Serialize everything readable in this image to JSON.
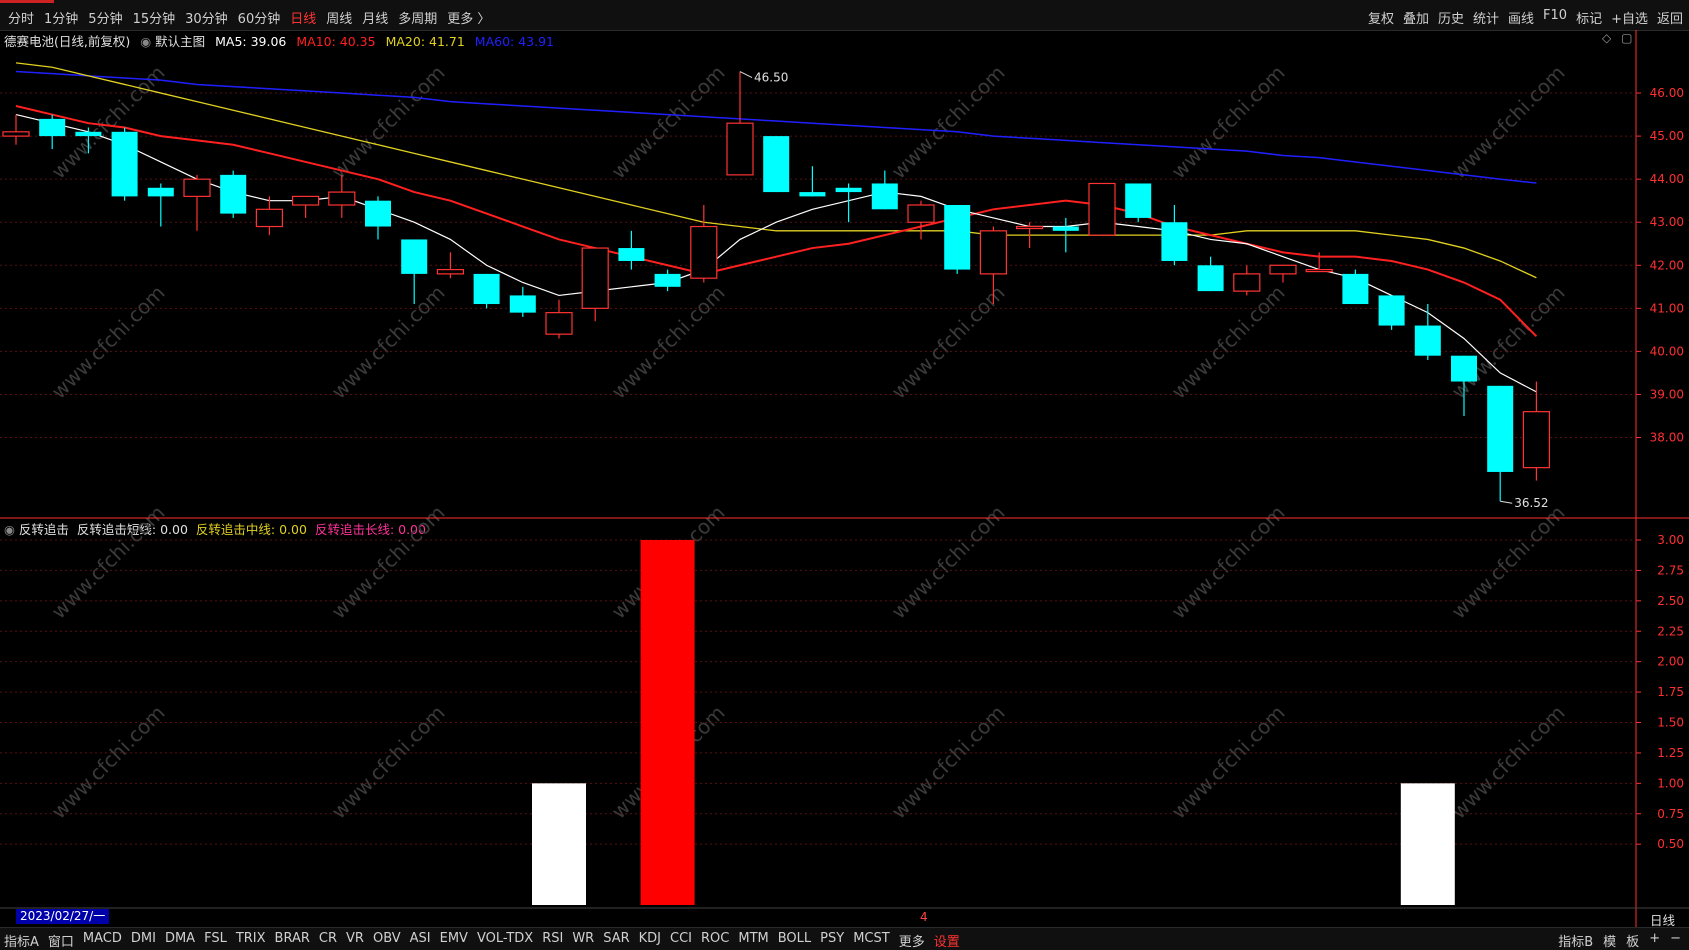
{
  "topbar": {
    "left": [
      "分时",
      "1分钟",
      "5分钟",
      "15分钟",
      "30分钟",
      "60分钟",
      "日线",
      "周线",
      "月线",
      "多周期",
      "更多 〉"
    ],
    "active_index": 6,
    "right": [
      "复权",
      "叠加",
      "历史",
      "统计",
      "画线",
      "F10",
      "标记",
      "+自选",
      "返回"
    ]
  },
  "main_info": {
    "stock": "德赛电池(日线,前复权)",
    "template": "默认主图",
    "ma5": "MA5: 39.06",
    "ma10": "MA10: 40.35",
    "ma20": "MA20: 41.71",
    "ma60": "MA60: 43.91"
  },
  "sub_info": {
    "name": "反转追击",
    "short": "反转追击短线: 0.00",
    "mid": "反转追击中线: 0.00",
    "long": "反转追击长线: 0.00"
  },
  "colors": {
    "up": "#ff3333",
    "down": "#00ffff",
    "ma5": "#ffffff",
    "ma10": "#ff2020",
    "ma20": "#e0d020",
    "ma60": "#2020ff",
    "axis": "#ff3030"
  },
  "annotations": {
    "high": "46.50",
    "low": "36.52"
  },
  "price_axis": [
    "46.00",
    "45.00",
    "44.00",
    "43.00",
    "42.00",
    "41.00",
    "40.00",
    "39.00",
    "38.00"
  ],
  "sub_axis": [
    "3.00",
    "2.75",
    "2.50",
    "2.25",
    "2.00",
    "1.75",
    "1.50",
    "1.25",
    "1.00",
    "0.75",
    "0.50"
  ],
  "date_label": "2023/02/27/一",
  "month_marker": "4",
  "period_label": "日线",
  "watermark": "www.cfchi.com",
  "bottombar": {
    "left": [
      "指标A",
      "窗口",
      "MACD",
      "DMI",
      "DMA",
      "FSL",
      "TRIX",
      "BRAR",
      "CR",
      "VR",
      "OBV",
      "ASI",
      "EMV",
      "VOL-TDX",
      "RSI",
      "WR",
      "SAR",
      "KDJ",
      "CCI",
      "ROC",
      "MTM",
      "BOLL",
      "PSY",
      "MCST",
      "更多",
      "设置"
    ],
    "right": [
      "指标B",
      "模",
      "板",
      "+",
      "−"
    ]
  },
  "chart_data": {
    "type": "candlestick",
    "price_range": [
      36.2,
      47.0
    ],
    "candles": [
      {
        "o": 45.0,
        "h": 45.5,
        "l": 44.8,
        "c": 45.1
      },
      {
        "o": 45.4,
        "h": 45.5,
        "l": 44.7,
        "c": 45.0
      },
      {
        "o": 45.1,
        "h": 45.2,
        "l": 44.6,
        "c": 45.0
      },
      {
        "o": 45.1,
        "h": 45.2,
        "l": 43.5,
        "c": 43.6
      },
      {
        "o": 43.8,
        "h": 43.9,
        "l": 42.9,
        "c": 43.6
      },
      {
        "o": 43.6,
        "h": 44.1,
        "l": 42.8,
        "c": 44.0
      },
      {
        "o": 44.1,
        "h": 44.2,
        "l": 43.1,
        "c": 43.2
      },
      {
        "o": 42.9,
        "h": 43.6,
        "l": 42.7,
        "c": 43.3
      },
      {
        "o": 43.4,
        "h": 43.6,
        "l": 43.1,
        "c": 43.6
      },
      {
        "o": 43.4,
        "h": 44.1,
        "l": 43.1,
        "c": 43.7
      },
      {
        "o": 43.5,
        "h": 43.6,
        "l": 42.6,
        "c": 42.9
      },
      {
        "o": 42.6,
        "h": 42.6,
        "l": 41.1,
        "c": 41.8
      },
      {
        "o": 41.8,
        "h": 42.3,
        "l": 41.7,
        "c": 41.9
      },
      {
        "o": 41.8,
        "h": 41.8,
        "l": 41.0,
        "c": 41.1
      },
      {
        "o": 41.3,
        "h": 41.5,
        "l": 40.8,
        "c": 40.9
      },
      {
        "o": 40.4,
        "h": 41.2,
        "l": 40.3,
        "c": 40.9
      },
      {
        "o": 41.0,
        "h": 42.4,
        "l": 40.7,
        "c": 42.4
      },
      {
        "o": 42.4,
        "h": 42.8,
        "l": 41.9,
        "c": 42.1
      },
      {
        "o": 41.8,
        "h": 41.9,
        "l": 41.4,
        "c": 41.5
      },
      {
        "o": 41.7,
        "h": 43.4,
        "l": 41.6,
        "c": 42.9
      },
      {
        "o": 44.1,
        "h": 46.5,
        "l": 44.1,
        "c": 45.3
      },
      {
        "o": 45.0,
        "h": 45.0,
        "l": 43.7,
        "c": 43.7
      },
      {
        "o": 43.7,
        "h": 44.3,
        "l": 43.6,
        "c": 43.6
      },
      {
        "o": 43.8,
        "h": 43.9,
        "l": 43.0,
        "c": 43.7
      },
      {
        "o": 43.9,
        "h": 44.2,
        "l": 43.3,
        "c": 43.3
      },
      {
        "o": 43.0,
        "h": 43.5,
        "l": 42.6,
        "c": 43.4
      },
      {
        "o": 43.4,
        "h": 43.4,
        "l": 41.8,
        "c": 41.9
      },
      {
        "o": 41.8,
        "h": 42.9,
        "l": 41.1,
        "c": 42.8
      },
      {
        "o": 42.9,
        "h": 43.0,
        "l": 42.4,
        "c": 42.9
      },
      {
        "o": 42.9,
        "h": 43.1,
        "l": 42.3,
        "c": 42.8
      },
      {
        "o": 42.7,
        "h": 43.9,
        "l": 42.7,
        "c": 43.9
      },
      {
        "o": 43.9,
        "h": 43.9,
        "l": 43.0,
        "c": 43.1
      },
      {
        "o": 43.0,
        "h": 43.4,
        "l": 42.0,
        "c": 42.1
      },
      {
        "o": 42.0,
        "h": 42.2,
        "l": 41.4,
        "c": 41.4
      },
      {
        "o": 41.4,
        "h": 42.0,
        "l": 41.3,
        "c": 41.8
      },
      {
        "o": 41.8,
        "h": 42.0,
        "l": 41.6,
        "c": 42.0
      },
      {
        "o": 41.9,
        "h": 42.3,
        "l": 41.9,
        "c": 41.9
      },
      {
        "o": 41.8,
        "h": 41.9,
        "l": 41.1,
        "c": 41.1
      },
      {
        "o": 41.3,
        "h": 41.3,
        "l": 40.5,
        "c": 40.6
      },
      {
        "o": 40.6,
        "h": 41.1,
        "l": 39.8,
        "c": 39.9
      },
      {
        "o": 39.9,
        "h": 39.9,
        "l": 38.5,
        "c": 39.3
      },
      {
        "o": 39.2,
        "h": 39.2,
        "l": 36.52,
        "c": 37.2
      },
      {
        "o": 37.3,
        "h": 39.3,
        "l": 37.0,
        "c": 38.6
      }
    ],
    "ma5": [
      45.5,
      45.3,
      45.1,
      44.8,
      44.4,
      44.0,
      43.7,
      43.5,
      43.5,
      43.6,
      43.3,
      43.0,
      42.6,
      42.0,
      41.6,
      41.3,
      41.4,
      41.5,
      41.6,
      41.9,
      42.6,
      43.0,
      43.3,
      43.5,
      43.7,
      43.6,
      43.3,
      43.1,
      42.9,
      42.9,
      43.0,
      42.9,
      42.8,
      42.6,
      42.5,
      42.2,
      41.9,
      41.7,
      41.3,
      40.9,
      40.3,
      39.5,
      39.06
    ],
    "ma10": [
      45.7,
      45.5,
      45.3,
      45.2,
      45.0,
      44.9,
      44.8,
      44.6,
      44.4,
      44.2,
      44.0,
      43.7,
      43.5,
      43.2,
      42.9,
      42.6,
      42.4,
      42.2,
      42.0,
      41.8,
      42.0,
      42.2,
      42.4,
      42.5,
      42.7,
      42.9,
      43.1,
      43.3,
      43.4,
      43.5,
      43.4,
      43.2,
      42.9,
      42.7,
      42.5,
      42.3,
      42.2,
      42.2,
      42.1,
      41.9,
      41.6,
      41.2,
      40.35
    ],
    "ma20": [
      46.7,
      46.6,
      46.4,
      46.2,
      46.0,
      45.8,
      45.6,
      45.4,
      45.2,
      45.0,
      44.8,
      44.6,
      44.4,
      44.2,
      44.0,
      43.8,
      43.6,
      43.4,
      43.2,
      43.0,
      42.9,
      42.8,
      42.8,
      42.8,
      42.8,
      42.8,
      42.8,
      42.7,
      42.7,
      42.7,
      42.7,
      42.7,
      42.7,
      42.7,
      42.8,
      42.8,
      42.8,
      42.8,
      42.7,
      42.6,
      42.4,
      42.1,
      41.71
    ],
    "ma60": [
      46.5,
      46.45,
      46.4,
      46.35,
      46.3,
      46.2,
      46.15,
      46.1,
      46.05,
      46.0,
      45.95,
      45.9,
      45.8,
      45.75,
      45.7,
      45.65,
      45.6,
      45.55,
      45.5,
      45.45,
      45.4,
      45.35,
      45.3,
      45.25,
      45.2,
      45.15,
      45.1,
      45.0,
      44.95,
      44.9,
      44.85,
      44.8,
      44.75,
      44.7,
      44.65,
      44.55,
      44.5,
      44.4,
      44.3,
      44.2,
      44.1,
      44.0,
      43.91
    ],
    "indicator": {
      "name": "反转追击",
      "y_range": [
        0,
        3.0
      ],
      "bars": [
        {
          "index": 15,
          "value": 1.0,
          "color": "#ffffff"
        },
        {
          "index": 18,
          "value": 3.0,
          "color": "#ff0000"
        },
        {
          "index": 39,
          "value": 1.0,
          "color": "#ffffff"
        }
      ]
    }
  }
}
